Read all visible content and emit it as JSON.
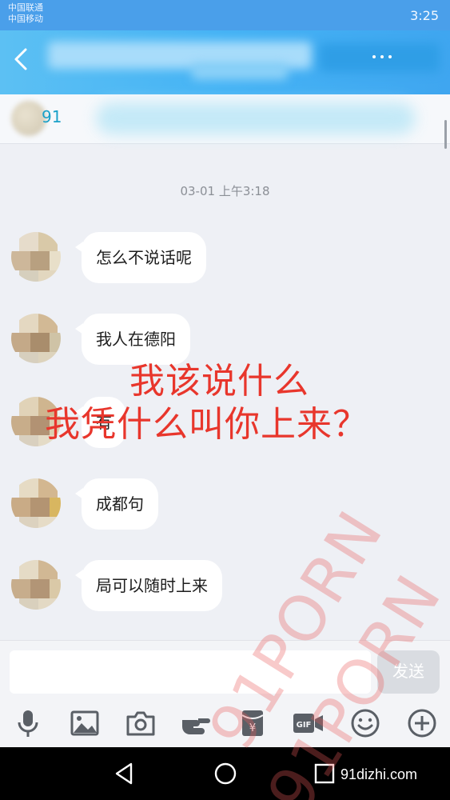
{
  "status_bar": {
    "carrier_1": "中国联通",
    "carrier_2": "中国移动",
    "time": "3:25"
  },
  "banner": {
    "text_prefix": "91"
  },
  "chat": {
    "timestamp": "03-01 上午3:18",
    "messages": [
      {
        "text": "怎么不说话呢"
      },
      {
        "text": "我人在德阳"
      },
      {
        "text": "有"
      },
      {
        "text": "成都句"
      },
      {
        "text": "局可以随时上来"
      }
    ]
  },
  "overlay": {
    "line1": "我该说什么",
    "line2": "我凭什么叫你上来？"
  },
  "watermark": {
    "text_1": "91PORN",
    "text_2": "91PORN",
    "site": "91dizhi.com"
  },
  "input_bar": {
    "send_label": "发送"
  },
  "icons": {
    "back": "back-arrow-icon",
    "mic": "mic-icon",
    "image": "image-icon",
    "camera": "camera-icon",
    "shake": "poke-icon",
    "redpacket": "red-packet-icon",
    "gif": "gif-icon",
    "emoji": "emoji-icon",
    "plus": "plus-icon"
  },
  "toolbar": {
    "gif_label": "GIF",
    "yuan_label": "¥"
  },
  "colors": {
    "accent": "#45b3f5",
    "overlay_text": "#e8362c",
    "bubble": "#ffffff",
    "background": "#eef0f5"
  }
}
